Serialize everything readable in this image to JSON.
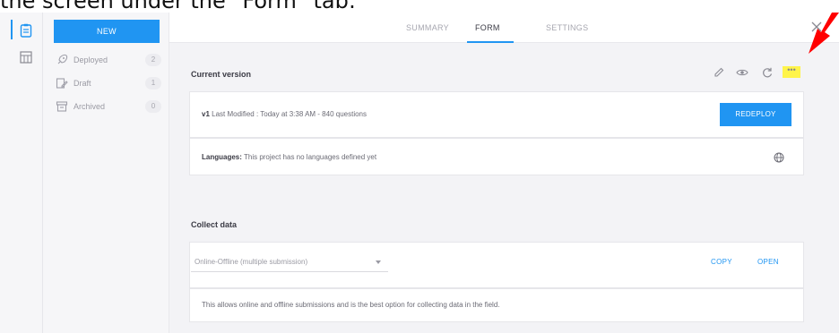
{
  "caption": "the screen under the \"Form\" tab:",
  "sidebar": {
    "new_button": "NEW",
    "items": [
      {
        "label": "Deployed",
        "count": "2"
      },
      {
        "label": "Draft",
        "count": "1"
      },
      {
        "label": "Archived",
        "count": "0"
      }
    ]
  },
  "tabs": [
    {
      "label": "SUMMARY"
    },
    {
      "label": "FORM"
    },
    {
      "label": "SETTINGS"
    }
  ],
  "current_version": {
    "title": "Current version",
    "more_label": "•••",
    "version_label": "v1",
    "last_modified": "Last Modified : Today at 3:38 AM - 840 questions",
    "redeploy_label": "REDEPLOY",
    "languages_label": "Languages:",
    "languages_text": "This project has no languages defined yet"
  },
  "collect_data": {
    "title": "Collect data",
    "select_value": "Online-Offline (multiple submission)",
    "copy_label": "COPY",
    "open_label": "OPEN",
    "description": "This allows online and offline submissions and is the best option for collecting data in the field."
  },
  "colors": {
    "accent": "#2095f2",
    "highlight": "#fff44a",
    "arrow": "#ff0000"
  }
}
